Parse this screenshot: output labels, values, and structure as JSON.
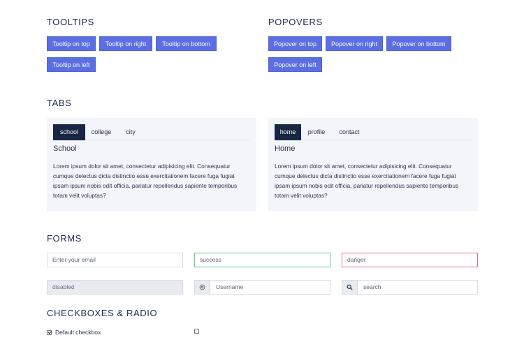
{
  "tooltips": {
    "heading": "TOOLTIPS",
    "buttons": [
      "Tooltip on top",
      "Tooltip on right",
      "Tooltip on bottom",
      "Tooltip on left"
    ]
  },
  "popovers": {
    "heading": "POPOVERS",
    "buttons": [
      "Popover on top",
      "Popover on right",
      "Popover on bottom",
      "Popover on left"
    ]
  },
  "tabs": {
    "heading": "TABS",
    "left": {
      "tabs": [
        "school",
        "college",
        "city"
      ],
      "active": "school",
      "title": "School",
      "text": "Lorem ipsum dolor sit amet, consectetur adipisicing elit. Consequatur cumque delectus dicta distinctio esse exercitationem facere fuga fugiat ipsam ipsum nobis odit officia, pariatur repellendus sapiente temporibus totam velit voluptas?"
    },
    "right": {
      "tabs": [
        "home",
        "profile",
        "contact"
      ],
      "active": "home",
      "title": "Home",
      "text": "Lorem ipsum dolor sit amet, consectetur adipisicing elit. Consequatur cumque delectus dicta distinctio esse exercitationem facere fuga fugiat ipsam ipsum nobis odit officia, pariatur repellendus sapiente temporibus totam velit voluptas?"
    }
  },
  "forms": {
    "heading": "FORMS",
    "email_placeholder": "Enter your email",
    "success_value": "success",
    "danger_value": "danger",
    "disabled_value": "disabled",
    "username_placeholder": "Username",
    "search_placeholder": "search"
  },
  "checkboxes": {
    "heading": "CHECKBOXES & RADIO",
    "default_label": "Default checkbox",
    "default_checked": true
  },
  "colors": {
    "primary": "#5b6fe2",
    "dark": "#172643",
    "success": "#5fd08e",
    "danger": "#ee6c8d",
    "card_bg": "#f2f5f9"
  }
}
